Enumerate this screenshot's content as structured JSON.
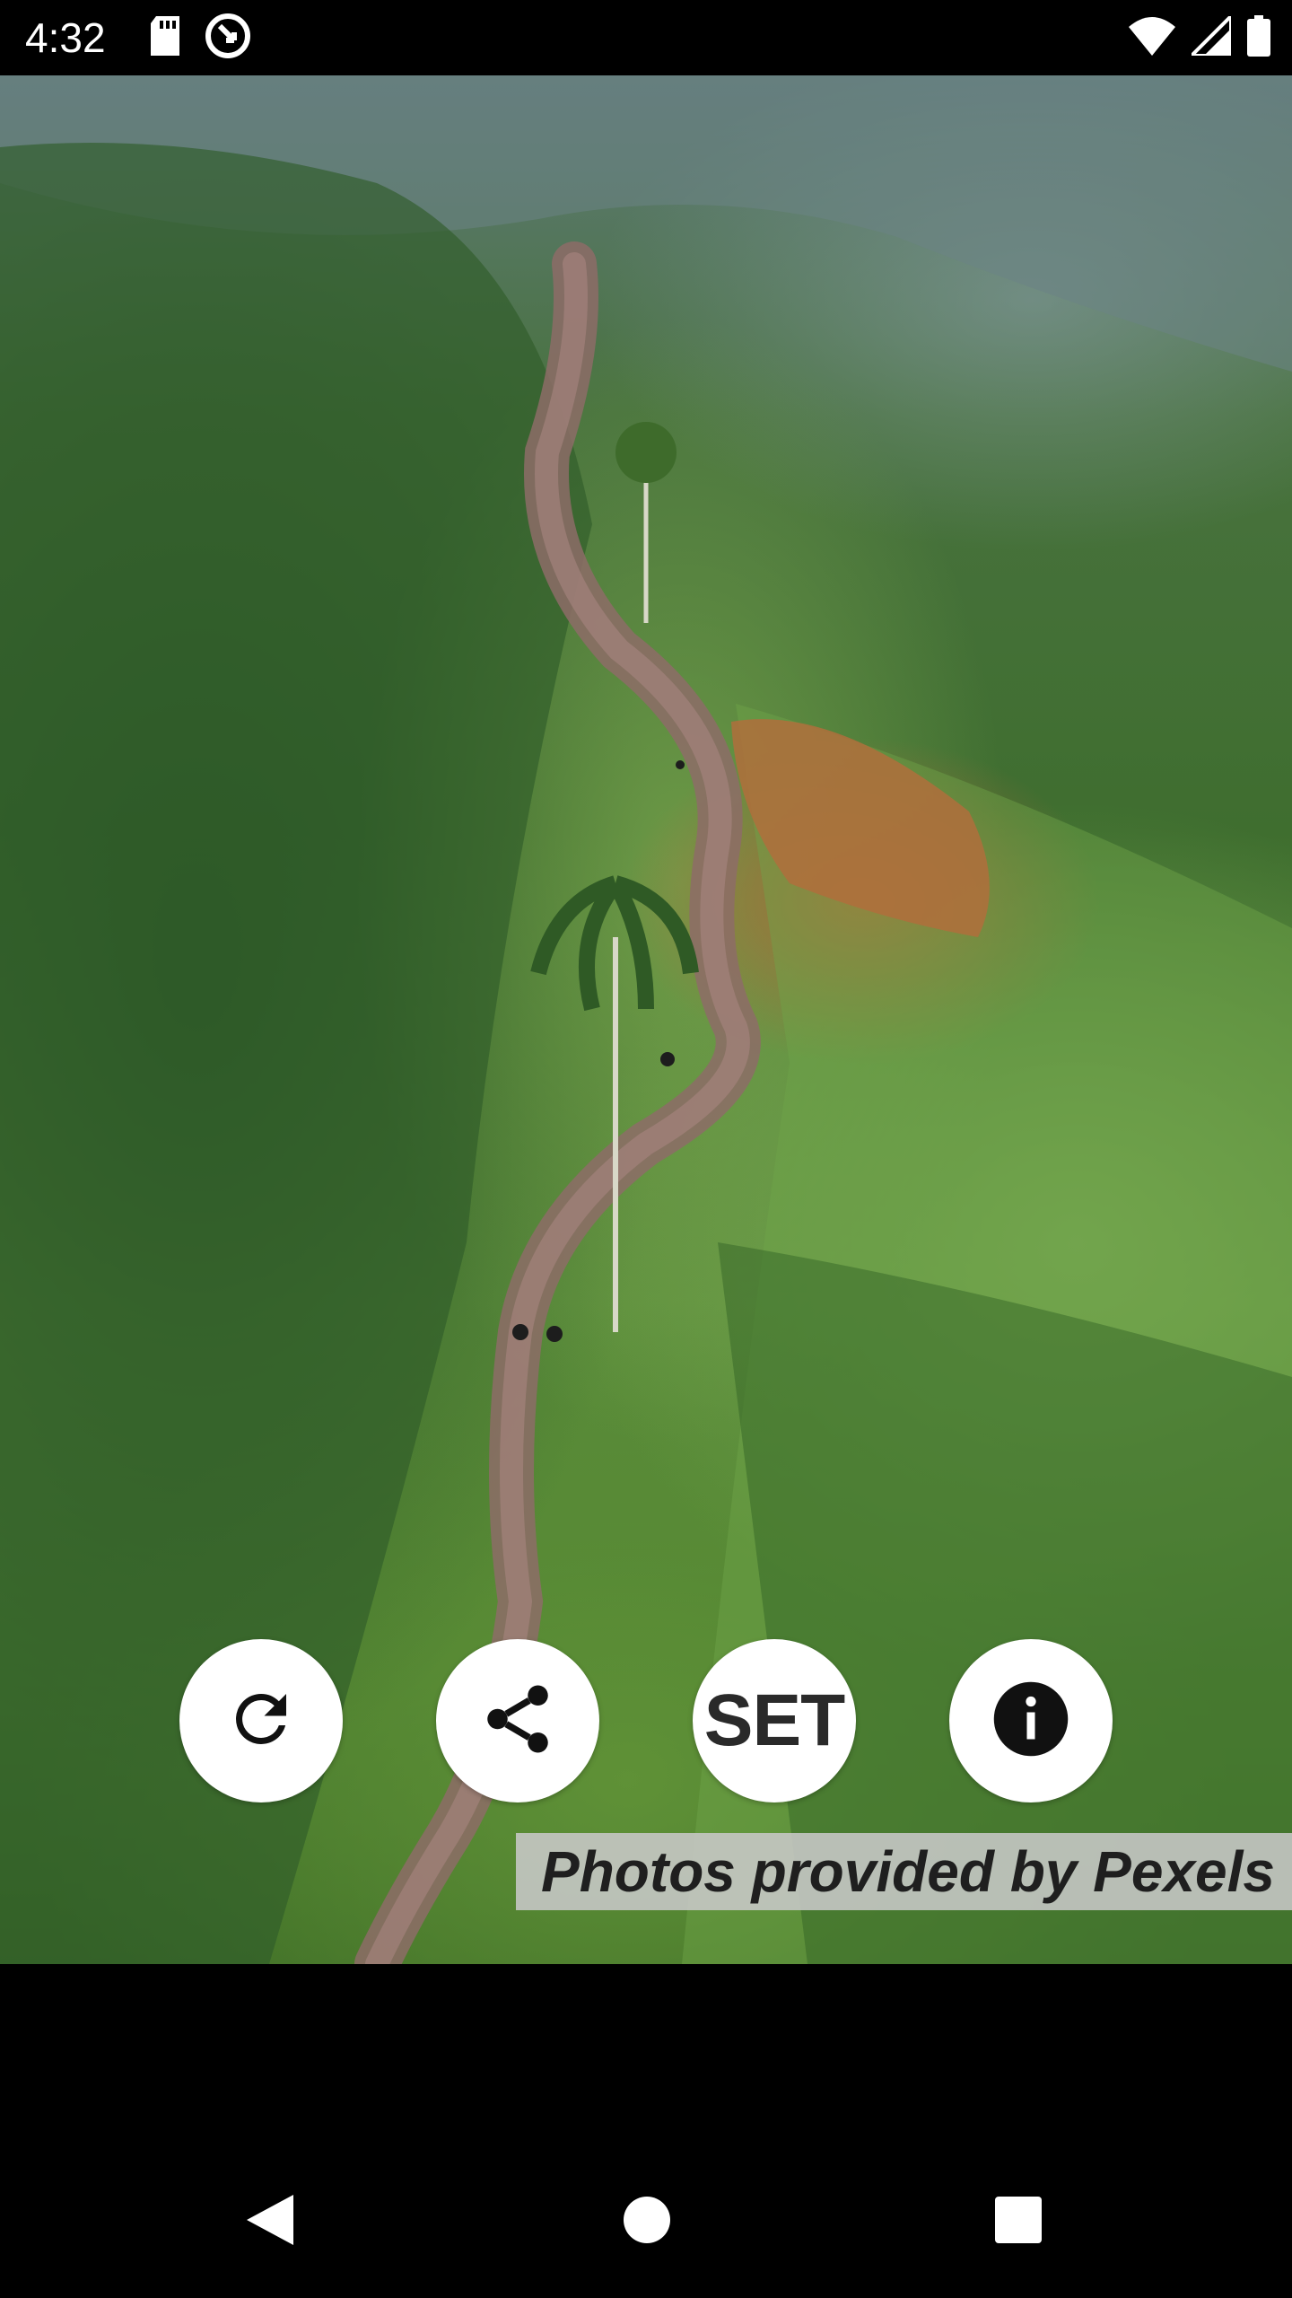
{
  "status_bar": {
    "time": "4:32",
    "left_icons": [
      "sd-card-icon",
      "sync-icon"
    ],
    "right_icons": [
      "wifi-icon",
      "signal-icon",
      "battery-icon"
    ]
  },
  "photo": {
    "subject": "aerial hillside path"
  },
  "actions": {
    "refresh_icon": "refresh-icon",
    "share_icon": "share-icon",
    "set_label": "SET",
    "info_icon": "info-icon"
  },
  "credits": {
    "text": "Photos provided by Pexels"
  },
  "nav_bar": {
    "icons": [
      "back-icon",
      "home-icon",
      "recents-icon"
    ]
  }
}
